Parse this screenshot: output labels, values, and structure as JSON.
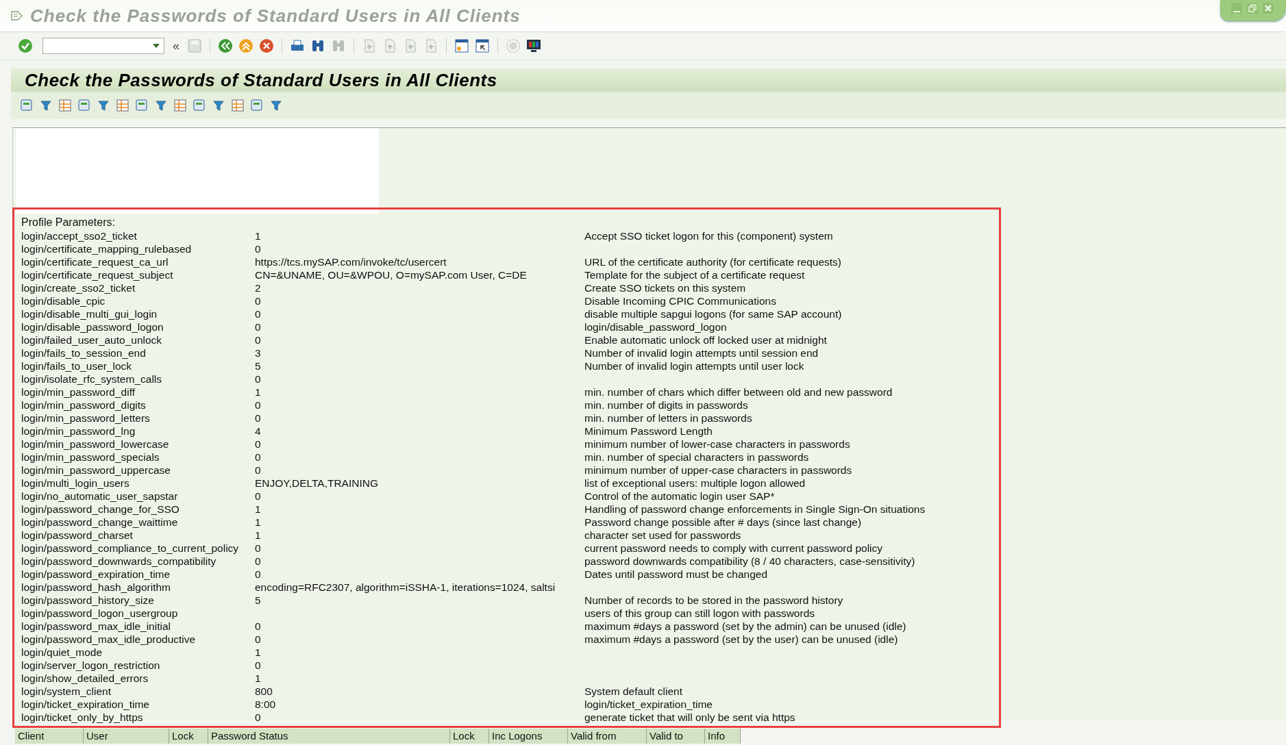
{
  "window": {
    "title": "Check the Passwords of Standard Users in All Clients"
  },
  "toolbar": {
    "collapse_glyph": "«"
  },
  "screen_title": "Check the Passwords of Standard Users in All Clients",
  "report": {
    "heading": "Profile Parameters:",
    "rows": [
      {
        "name": "login/accept_sso2_ticket",
        "value": "1",
        "description": "Accept SSO ticket logon for this (component) system"
      },
      {
        "name": "login/certificate_mapping_rulebased",
        "value": "0",
        "description": ""
      },
      {
        "name": "login/certificate_request_ca_url",
        "value": "https://tcs.mySAP.com/invoke/tc/usercert",
        "description": "URL of the certificate authority (for certificate requests)"
      },
      {
        "name": "login/certificate_request_subject",
        "value": "CN=&UNAME, OU=&WPOU, O=mySAP.com User, C=DE",
        "description": "Template for the subject of a certificate request"
      },
      {
        "name": "login/create_sso2_ticket",
        "value": "2",
        "description": "Create SSO tickets on this system"
      },
      {
        "name": "login/disable_cpic",
        "value": "0",
        "description": "Disable Incoming CPIC Communications"
      },
      {
        "name": "login/disable_multi_gui_login",
        "value": "0",
        "description": "disable multiple sapgui logons (for same SAP account)"
      },
      {
        "name": "login/disable_password_logon",
        "value": "0",
        "description": "login/disable_password_logon"
      },
      {
        "name": "login/failed_user_auto_unlock",
        "value": "0",
        "description": "Enable automatic unlock off locked user at midnight"
      },
      {
        "name": "login/fails_to_session_end",
        "value": "3",
        "description": "Number of invalid login attempts until session end"
      },
      {
        "name": "login/fails_to_user_lock",
        "value": "5",
        "description": "Number of invalid login attempts until user lock"
      },
      {
        "name": "login/isolate_rfc_system_calls",
        "value": "0",
        "description": ""
      },
      {
        "name": "login/min_password_diff",
        "value": "1",
        "description": "min. number of chars which differ between old and new password"
      },
      {
        "name": "login/min_password_digits",
        "value": "0",
        "description": "min. number of digits in passwords"
      },
      {
        "name": "login/min_password_letters",
        "value": "0",
        "description": "min. number of letters in passwords"
      },
      {
        "name": "login/min_password_lng",
        "value": "4",
        "description": "Minimum Password Length"
      },
      {
        "name": "login/min_password_lowercase",
        "value": "0",
        "description": "minimum number of lower-case characters in passwords"
      },
      {
        "name": "login/min_password_specials",
        "value": "0",
        "description": "min. number of special characters in passwords"
      },
      {
        "name": "login/min_password_uppercase",
        "value": "0",
        "description": "minimum number of upper-case characters in passwords"
      },
      {
        "name": "login/multi_login_users",
        "value": "ENJOY,DELTA,TRAINING",
        "description": "list of exceptional users: multiple logon allowed"
      },
      {
        "name": "login/no_automatic_user_sapstar",
        "value": "0",
        "description": "Control of the automatic login user SAP*"
      },
      {
        "name": "login/password_change_for_SSO",
        "value": "1",
        "description": "Handling of password change enforcements in Single Sign-On situations"
      },
      {
        "name": "login/password_change_waittime",
        "value": "1",
        "description": "Password change possible after # days (since last change)"
      },
      {
        "name": "login/password_charset",
        "value": "1",
        "description": "character set used for passwords"
      },
      {
        "name": "login/password_compliance_to_current_policy",
        "value": "0",
        "description": "current password needs to comply with current password policy"
      },
      {
        "name": "login/password_downwards_compatibility",
        "value": "0",
        "description": "password downwards compatibility (8 / 40 characters, case-sensitivity)"
      },
      {
        "name": "login/password_expiration_time",
        "value": "0",
        "description": "Dates until password must be changed"
      },
      {
        "name": "login/password_hash_algorithm",
        "value": "encoding=RFC2307, algorithm=iSSHA-1, iterations=1024, saltsi",
        "description": ""
      },
      {
        "name": "login/password_history_size",
        "value": "5",
        "description": "Number of records to be stored in the password history"
      },
      {
        "name": "login/password_logon_usergroup",
        "value": "",
        "description": "users of this group can still logon with passwords"
      },
      {
        "name": "login/password_max_idle_initial",
        "value": "0",
        "description": "maximum #days a password (set by the admin) can be unused (idle)"
      },
      {
        "name": "login/password_max_idle_productive",
        "value": "0",
        "description": "maximum #days a password (set by the user) can be unused (idle)"
      },
      {
        "name": "login/quiet_mode",
        "value": "1",
        "description": ""
      },
      {
        "name": "login/server_logon_restriction",
        "value": "0",
        "description": ""
      },
      {
        "name": "login/show_detailed_errors",
        "value": "1",
        "description": ""
      },
      {
        "name": "login/system_client",
        "value": "800",
        "description": "System default client"
      },
      {
        "name": "login/ticket_expiration_time",
        "value": "8:00",
        "description": "login/ticket_expiration_time"
      },
      {
        "name": "login/ticket_only_by_https",
        "value": "0",
        "description": "generate ticket that will only be sent via https"
      }
    ]
  },
  "table": {
    "columns": [
      "Client",
      "User",
      "Lock",
      "Password Status",
      "Lock",
      "Inc Logons",
      "Valid from",
      "Valid to",
      "Info"
    ]
  }
}
